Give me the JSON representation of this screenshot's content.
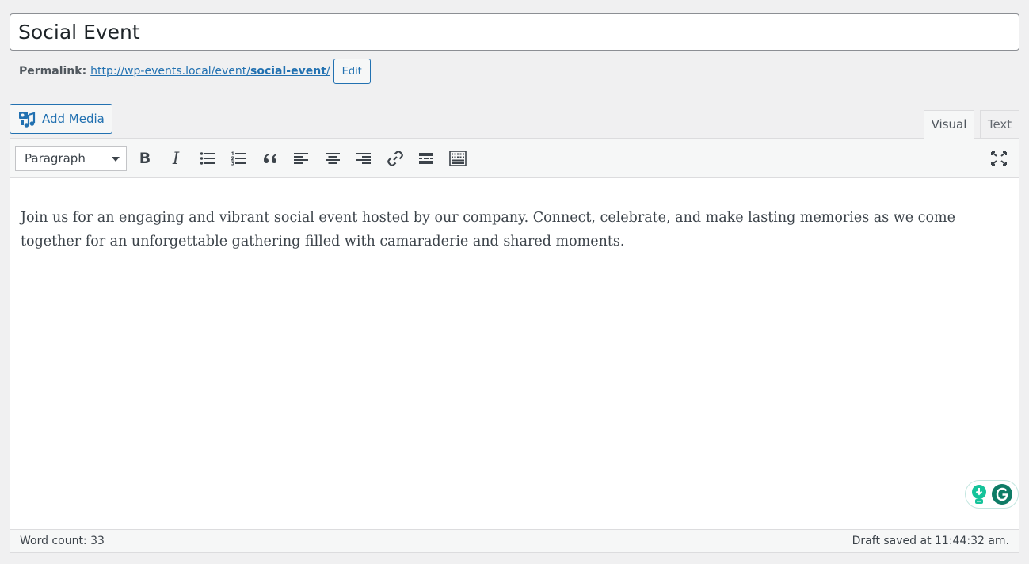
{
  "title": {
    "value": "Social Event"
  },
  "permalink": {
    "label": "Permalink:",
    "url_base": "http://wp-events.local/event/",
    "url_slug": "social-event",
    "url_trail": "/",
    "edit_label": "Edit"
  },
  "media": {
    "add_label": "Add Media"
  },
  "tabs": {
    "visual": "Visual",
    "text": "Text"
  },
  "toolbar": {
    "format": "Paragraph",
    "buttons": [
      "bold-icon",
      "italic-icon",
      "bulleted-list-icon",
      "numbered-list-icon",
      "blockquote-icon",
      "align-left-icon",
      "align-center-icon",
      "align-right-icon",
      "link-icon",
      "read-more-icon",
      "toolbar-toggle-icon",
      "fullscreen-icon"
    ]
  },
  "content": {
    "text": "Join us for an engaging and vibrant social event hosted by our company. Connect, celebrate, and make lasting memories as we come together for an unforgettable gathering filled with camaraderie and shared moments."
  },
  "status": {
    "word_count": "Word count: 33",
    "draft_saved": "Draft saved at 11:44:32 am."
  },
  "colors": {
    "accent": "#2271b1",
    "grammarly": "#15c39a",
    "grammarly_dark": "#0e7c66"
  }
}
